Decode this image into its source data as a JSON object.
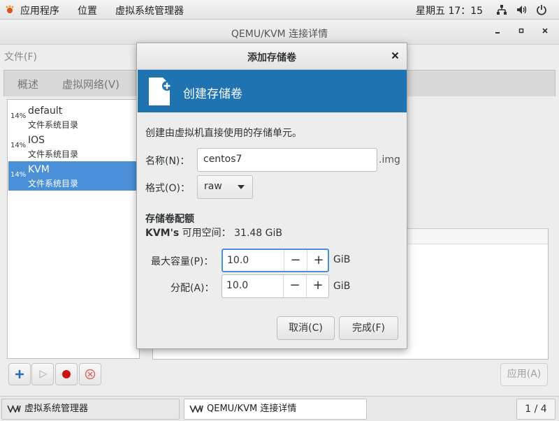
{
  "topbar": {
    "applications": "应用程序",
    "places": "位置",
    "app_menu": "虚拟系统管理器",
    "clock": "星期五 17：15",
    "icons": [
      "network-icon",
      "volume-icon",
      "power-icon"
    ]
  },
  "main_window": {
    "title": "QEMU/KVM 连接详情",
    "menu_file": "文件(F)",
    "tabs": [
      "概述",
      "虚拟网络(V)"
    ],
    "pools": [
      {
        "percent": "14%",
        "name": "default",
        "type": "文件系统目录"
      },
      {
        "percent": "14%",
        "name": "IOS",
        "type": "文件系统目录"
      },
      {
        "percent": "14%",
        "name": "KVM",
        "type": "文件系统目录",
        "selected": true
      }
    ],
    "apply_button": "应用(A)"
  },
  "dialog": {
    "title": "添加存储卷",
    "banner": "创建存储卷",
    "description": "创建由虚拟机直接使用的存储单元。",
    "name_label": "名称(N)：",
    "name_value": "centos7",
    "name_suffix": ".img",
    "format_label": "格式(O)：",
    "format_value": "raw",
    "quota_heading": "存储卷配额",
    "free_space_prefix": "KVM's",
    "free_space_text": " 可用空间： 31.48 GiB",
    "max_capacity_label": "最大容量(P)：",
    "max_capacity_value": "10.0",
    "allocation_label": "分配(A)：",
    "allocation_value": "10.0",
    "unit": "GiB",
    "cancel_button": "取消(C)",
    "finish_button": "完成(F)"
  },
  "taskbar": {
    "tasks": [
      "虚拟系统管理器",
      "QEMU/KVM 连接详情"
    ],
    "pager": "1 / 4"
  },
  "colors": {
    "banner": "#1f73b1",
    "selection": "#4a90d9",
    "stop_red": "#cc1111"
  }
}
